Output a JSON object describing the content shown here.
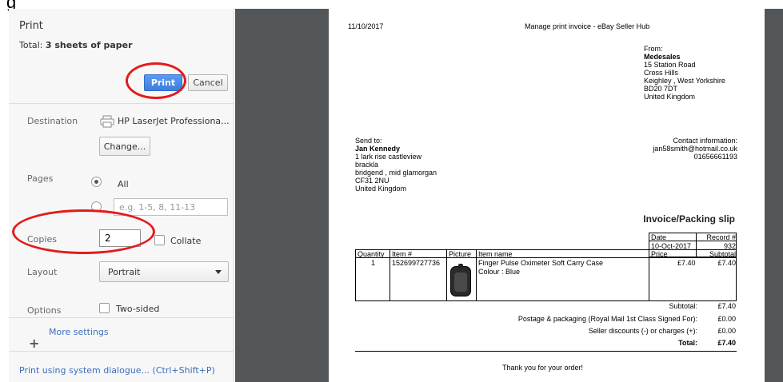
{
  "window_fragment": "g",
  "dialog": {
    "title": "Print",
    "total_label": "Total:",
    "total_value": "3 sheets of paper",
    "print_button": "Print",
    "cancel_button": "Cancel",
    "destination_label": "Destination",
    "destination_value": "HP LaserJet Professiona...",
    "change_button": "Change...",
    "pages_label": "Pages",
    "pages_all_label": "All",
    "pages_custom_placeholder": "e.g. 1-5, 8, 11-13",
    "copies_label": "Copies",
    "copies_value": "2",
    "collate_label": "Collate",
    "layout_label": "Layout",
    "layout_value": "Portrait",
    "options_label": "Options",
    "two_sided_label": "Two-sided",
    "more_settings": "More settings",
    "system_dialog_link": "Print using system dialogue... (Ctrl+Shift+P)"
  },
  "annotation_color": "#e21b1b",
  "preview": {
    "date_header": "11/10/2017",
    "page_title": "Manage print invoice - eBay Seller Hub",
    "from_label": "From:",
    "from_name": "Medesales",
    "from_lines": [
      "15 Station Road",
      "Cross Hills",
      "Keighley , West Yorkshire",
      "BD20 7DT",
      "United Kingdom"
    ],
    "send_to_label": "Send to:",
    "to_name": "Jan Kennedy",
    "to_lines": [
      "1 lark rise castleview",
      "brackla",
      "bridgend , mid glamorgan",
      "CF31 2NU",
      "United Kingdom"
    ],
    "contact_label": "Contact information:",
    "contact_email": "jan58smith@hotmail.co.uk",
    "contact_phone": "01656661193",
    "invoice_title": "Invoice/Packing slip",
    "date_col": "Date",
    "record_col": "Record #",
    "date_value": "10-Oct-2017",
    "record_value": "932",
    "col_quantity": "Quantity",
    "col_item": "Item #",
    "col_picture": "Picture",
    "col_item_name": "Item name",
    "col_price": "Price",
    "col_subtotal": "Subtotal",
    "row_quantity": "1",
    "row_item": "152699727736",
    "row_item_name": "Finger Pulse Oximeter Soft Carry Case",
    "row_colour": "Colour : Blue",
    "row_price": "£7.40",
    "row_subtotal": "£7.40",
    "subtotal_label": "Subtotal:",
    "subtotal_value": "£7.40",
    "postage_label": "Postage & packaging (Royal Mail 1st Class Signed For):",
    "postage_value": "£0.00",
    "discounts_label": "Seller discounts (-) or charges (+):",
    "discounts_value": "£0.00",
    "total_label": "Total:",
    "total_value": "£7.40",
    "thanks": "Thank you for your order!"
  }
}
